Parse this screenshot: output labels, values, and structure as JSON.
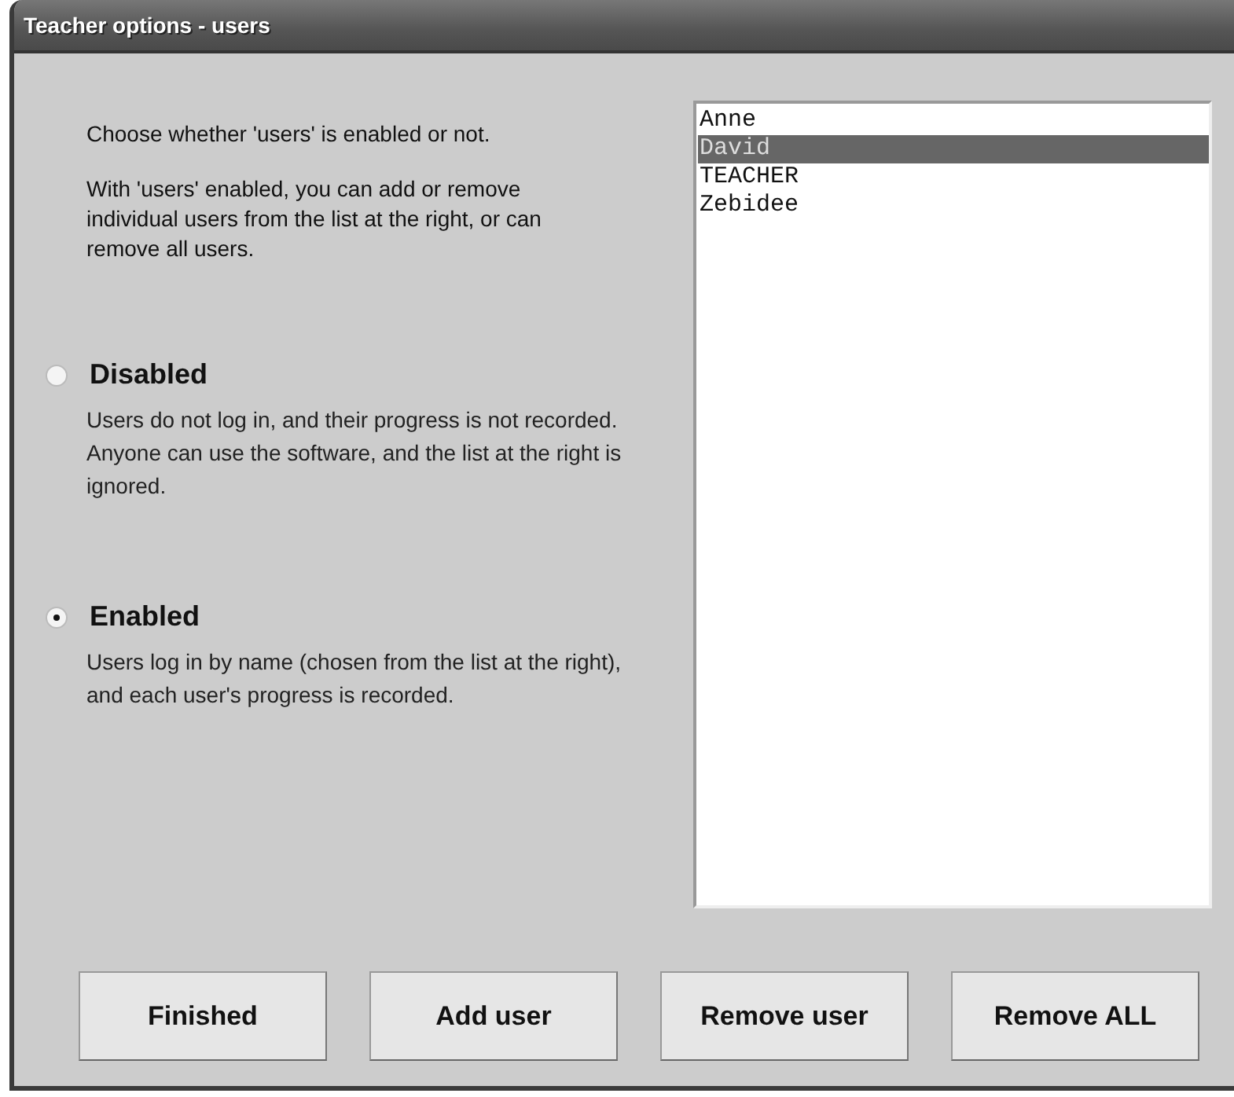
{
  "window": {
    "title": "Teacher options - users"
  },
  "intro": [
    "Choose whether 'users' is enabled or not.",
    "With 'users' enabled, you can add or remove individual users from the list at the right, or can remove all users."
  ],
  "options": [
    {
      "label": "Disabled",
      "selected": false,
      "description": "Users do not log in, and their progress is not recorded.  Anyone can use the software, and the list at the right is ignored."
    },
    {
      "label": "Enabled",
      "selected": true,
      "description": "Users log in by name (chosen from the list at the right), and each user's progress is recorded."
    }
  ],
  "users": [
    {
      "name": "Anne",
      "selected": false
    },
    {
      "name": "David",
      "selected": true
    },
    {
      "name": "TEACHER",
      "selected": false
    },
    {
      "name": "Zebidee",
      "selected": false
    }
  ],
  "buttons": [
    "Finished",
    "Add user",
    "Remove user",
    "Remove ALL"
  ]
}
